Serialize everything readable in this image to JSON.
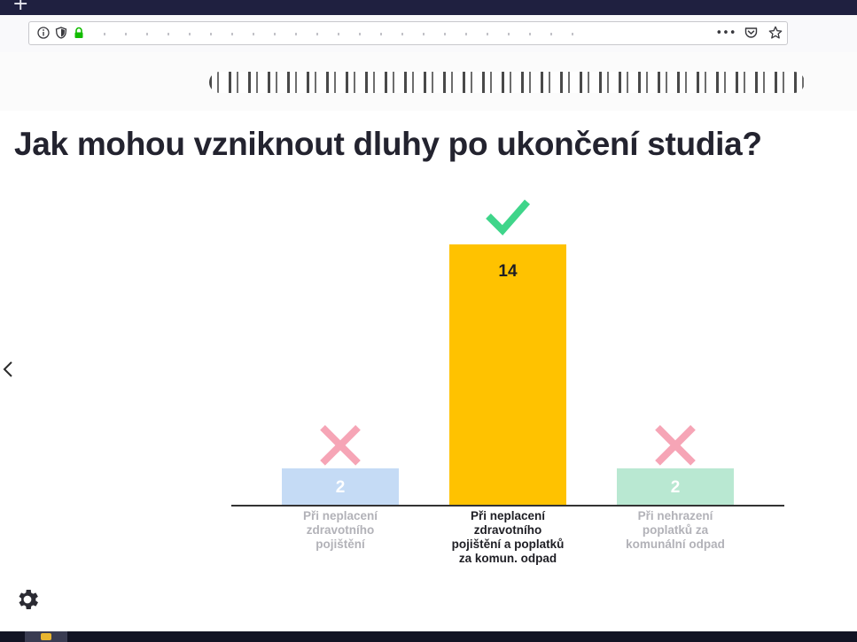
{
  "browser": {
    "new_tab_label": "+",
    "toolbar_icons": [
      "info-icon",
      "shield-icon",
      "lock-icon",
      "more-icon",
      "pocket-icon",
      "star-icon"
    ],
    "more_label": "•••"
  },
  "page": {
    "title": "Jak mohou vzniknout dluhy po ukončení studia?"
  },
  "colors": {
    "bar_blue": "#c5dbf5",
    "bar_yellow": "#ffc200",
    "bar_green": "#b9e8d2",
    "correct_green": "#3fd58a",
    "wrong_pink": "#f6a5b6",
    "title": "#23232f",
    "muted_label": "#b2b2b8",
    "axis": "#333333"
  },
  "chart_data": {
    "type": "bar",
    "categories": [
      [
        "Při neplacení",
        "zdravotního",
        "pojištění"
      ],
      [
        "Při neplacení",
        "zdravotního",
        "pojištění a poplatků",
        "za komun. odpad"
      ],
      [
        "Při nehrazení",
        "poplatků za",
        "komunální odpad"
      ]
    ],
    "values": [
      2,
      14,
      2
    ],
    "correct": [
      false,
      true,
      false
    ],
    "bar_colors": [
      "#c5dbf5",
      "#ffc200",
      "#b9e8d2"
    ],
    "label_colors": [
      "#b2b2b8",
      "#1e1e24",
      "#b2b2b8"
    ],
    "value_label_colors": [
      "#ffffff",
      "#1e1e24",
      "#ffffff"
    ],
    "ylim": [
      0,
      14
    ]
  }
}
